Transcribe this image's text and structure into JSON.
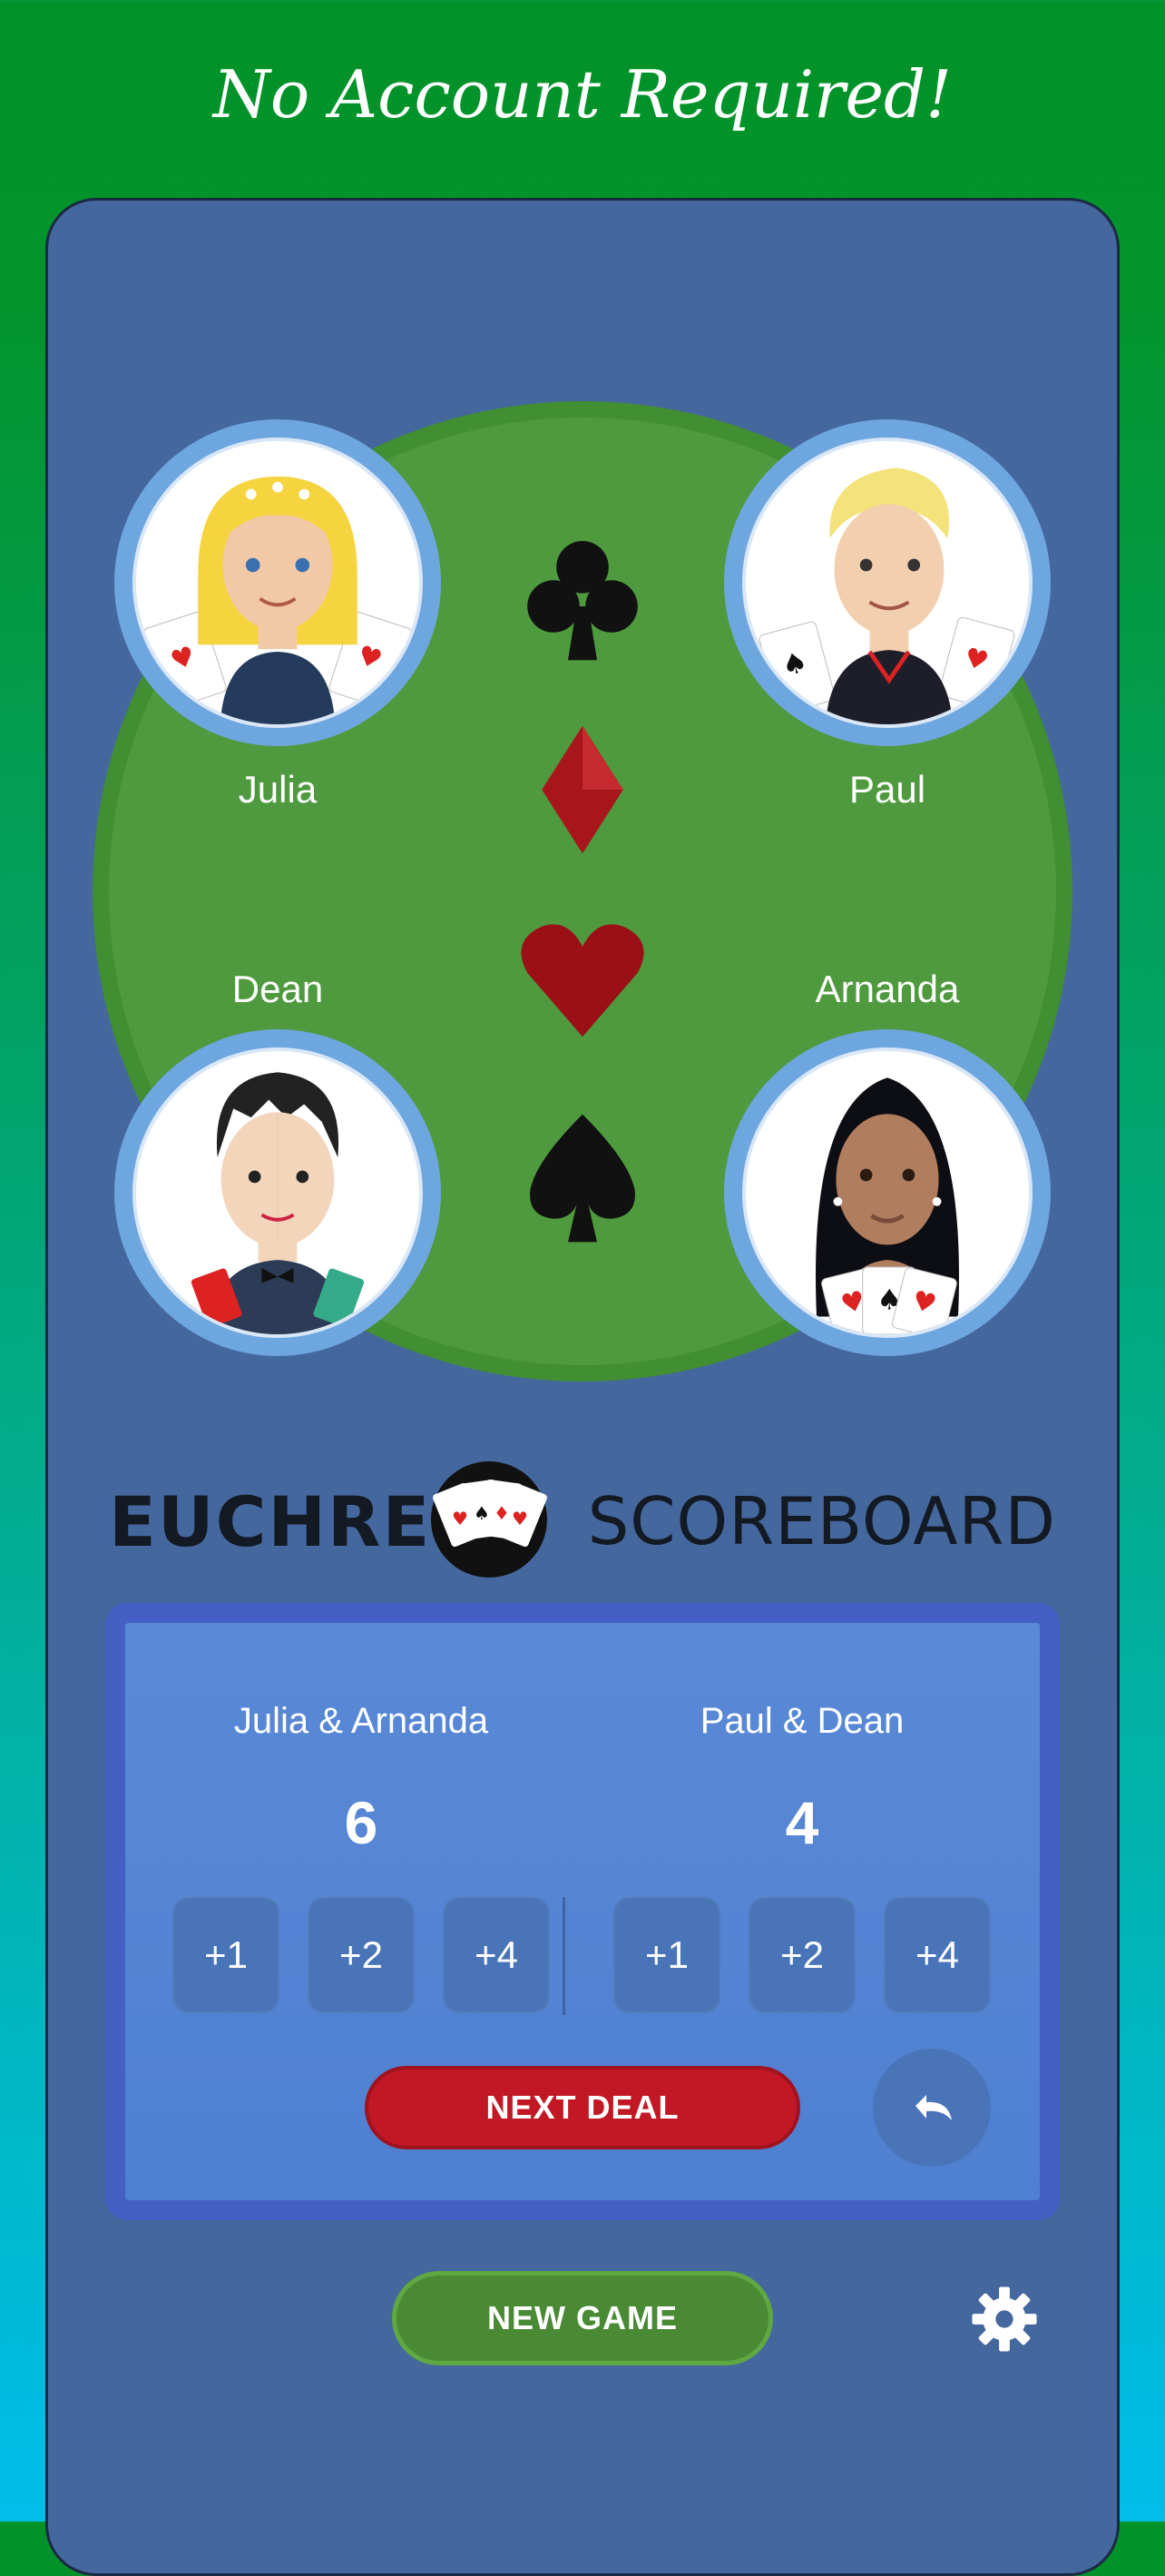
{
  "header": {
    "headline": "No Account Required!"
  },
  "players": {
    "top_left": {
      "name": "Julia"
    },
    "top_right": {
      "name": "Paul"
    },
    "bottom_left": {
      "name": "Dean"
    },
    "bottom_right": {
      "name": "Arnanda"
    }
  },
  "suits": [
    "clubs-icon",
    "diamonds-icon",
    "hearts-icon",
    "spades-icon"
  ],
  "logo": {
    "left": "EUCHRE",
    "right": "SCOREBOARD"
  },
  "scoreboard": {
    "team1": {
      "name": "Julia & Arnanda",
      "score": "6",
      "buttons": [
        "+1",
        "+2",
        "+4"
      ]
    },
    "team2": {
      "name": "Paul & Dean",
      "score": "4",
      "buttons": [
        "+1",
        "+2",
        "+4"
      ]
    },
    "next_deal_label": "NEXT DEAL"
  },
  "footer": {
    "new_game_label": "NEW GAME"
  },
  "colors": {
    "panel": "#44679e",
    "table": "#4f9a3e",
    "next_deal": "#c21826",
    "new_game": "#4a8a35",
    "score_card": "#4560c4"
  }
}
